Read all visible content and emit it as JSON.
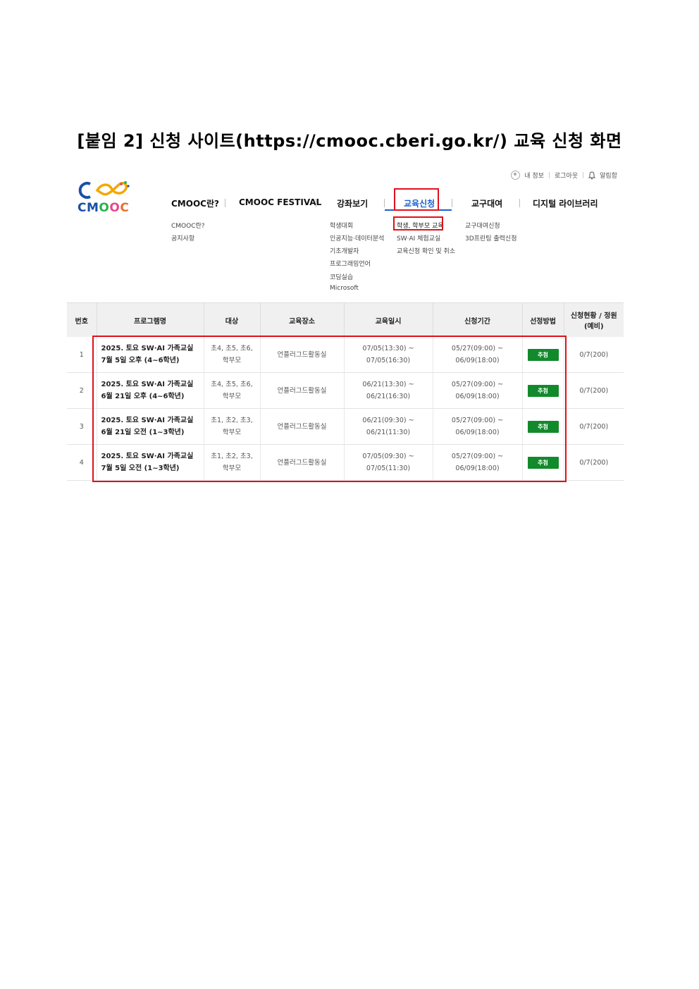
{
  "doc_title": "[붙임 2] 신청 사이트(https://cmooc.cberi.go.kr/) 교육 신청 화면",
  "util": {
    "myinfo": "내 정보",
    "logout": "로그아웃",
    "alarm": "알림함"
  },
  "logo": {
    "text": "CMOOC",
    "colors": {
      "c": "#1b4fa8",
      "m": "#f2a900",
      "o1": "#2bb24c",
      "o2": "#e64a8a",
      "c2": "#e8702a"
    }
  },
  "nav": [
    {
      "label": "CMOOC란?",
      "sub": [
        "CMOOC란?",
        "공지사항"
      ]
    },
    {
      "label": "CMOOC FESTIVAL",
      "sub": []
    },
    {
      "label": "강좌보기",
      "sub": [
        "학생대회",
        "인공지능·데이터분석",
        "기초개발자",
        "프로그래밍언어",
        "코딩실습",
        "Microsoft"
      ]
    },
    {
      "label": "교육신청",
      "sub": [
        "학생, 학부모 교육",
        "SW·AI 체험교실",
        "교육신청 확인 및 취소"
      ]
    },
    {
      "label": "교구대여",
      "sub": [
        "교구대여신청",
        "3D프린팅 출력신청"
      ]
    },
    {
      "label": "디지털 라이브러리",
      "sub": []
    }
  ],
  "table": {
    "headers": [
      "번호",
      "프로그램명",
      "대상",
      "교육장소",
      "교육일시",
      "신청기간",
      "선정방법",
      "신청현황 / 정원(예비)"
    ],
    "rows": [
      {
        "no": "1",
        "name": "2025. 토요 SW·AI 가족교실 7월 5일 오후 (4~6학년)",
        "target": "초4, 초5, 초6, 학부모",
        "place": "언플러그드활동실",
        "date": "07/05(13:30) ~ 07/05(16:30)",
        "period": "05/27(09:00) ~ 06/09(18:00)",
        "method": "추첨",
        "status": "0/7(200)"
      },
      {
        "no": "2",
        "name": "2025. 토요 SW·AI 가족교실 6월 21일 오후 (4~6학년)",
        "target": "초4, 초5, 초6, 학부모",
        "place": "언플러그드활동실",
        "date": "06/21(13:30) ~ 06/21(16:30)",
        "period": "05/27(09:00) ~ 06/09(18:00)",
        "method": "추첨",
        "status": "0/7(200)"
      },
      {
        "no": "3",
        "name": "2025. 토요 SW·AI 가족교실 6월 21일 오전 (1~3학년)",
        "target": "초1, 초2, 초3, 학부모",
        "place": "언플러그드활동실",
        "date": "06/21(09:30) ~ 06/21(11:30)",
        "period": "05/27(09:00) ~ 06/09(18:00)",
        "method": "추첨",
        "status": "0/7(200)"
      },
      {
        "no": "4",
        "name": "2025. 토요 SW·AI 가족교실 7월 5일 오전 (1~3학년)",
        "target": "초1, 초2, 초3, 학부모",
        "place": "언플러그드활동실",
        "date": "07/05(09:30) ~ 07/05(11:30)",
        "period": "05/27(09:00) ~ 06/09(18:00)",
        "method": "추첨",
        "status": "0/7(200)"
      }
    ]
  },
  "highlight_color": "#e0111a",
  "active_color": "#1b5fd0",
  "badge_color": "#128a2c"
}
